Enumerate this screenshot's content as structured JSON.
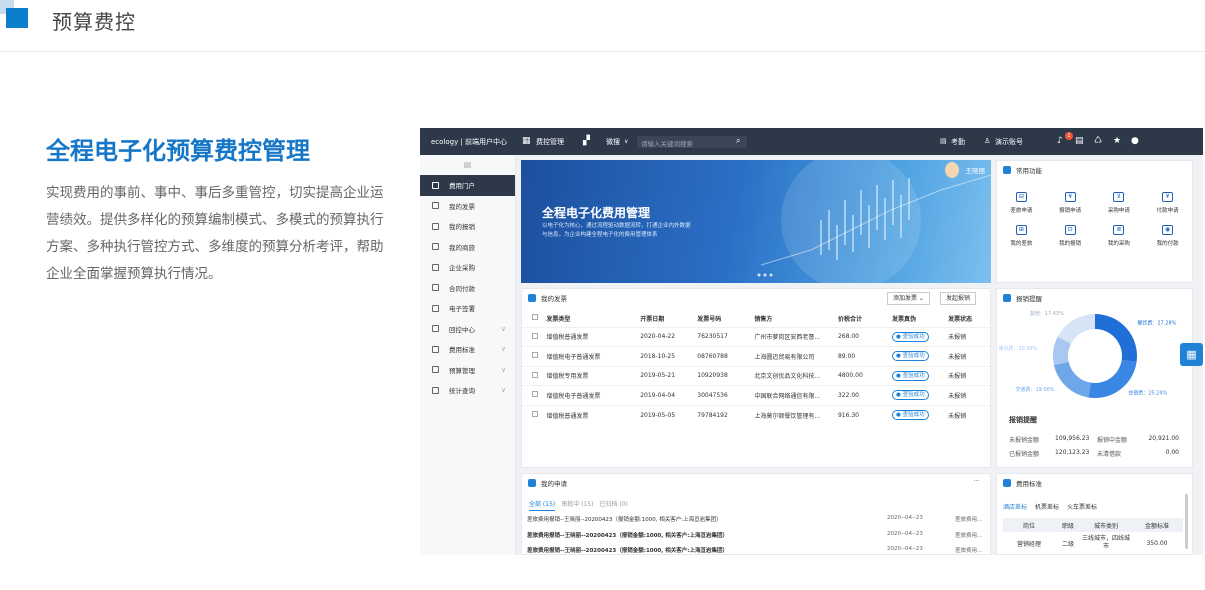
{
  "header": {
    "title": "预算费控"
  },
  "headline": "全程电子化预算费控管理",
  "description": "实现费用的事前、事中、事后多重管控，切实提高企业运营绩效。提供多样化的预算编制模式、多模式的预算执行方案、多种执行管控方式、多维度的预算分析考评，帮助企业全面掌握预算执行情况。",
  "app": {
    "brand": "ecology | 前端用户中心",
    "module": "费控管理",
    "search_scope": "微搜",
    "search_placeholder": "请输入关键词搜索",
    "attendance": "考勤",
    "account": "演示账号",
    "notification_count": "1",
    "sidebar": [
      {
        "label": "费用门户",
        "active": true
      },
      {
        "label": "我的发票"
      },
      {
        "label": "我的报销"
      },
      {
        "label": "我的商旅"
      },
      {
        "label": "企业采购"
      },
      {
        "label": "合同付款"
      },
      {
        "label": "电子签署"
      },
      {
        "label": "回控中心",
        "expand": true
      },
      {
        "label": "费用标准",
        "expand": true
      },
      {
        "label": "预算管理",
        "expand": true
      },
      {
        "label": "统计查询",
        "expand": true
      }
    ],
    "banner": {
      "title": "全程电子化费用管理",
      "subtitle": "以电子化为核心，通过流程驱动数据流转，打通企业内外数据与信息，为企业构建全程电子化的费用管理体系",
      "user": "王晓丽"
    },
    "quick": {
      "title": "常用功能",
      "items": [
        "差旅申请",
        "报销申请",
        "采购申请",
        "付款申请",
        "我的差旅",
        "我的报销",
        "我的采购",
        "我的付款"
      ],
      "icons": [
        "briefcase-icon",
        "yen-icon",
        "cart-icon",
        "payment-icon",
        "travel-icon",
        "receipt-icon",
        "purchase-icon",
        "pay-icon"
      ]
    },
    "invoices": {
      "title": "我的发票",
      "add_button": "添加发票",
      "reimburse_button": "发起报销",
      "columns": [
        "发票类型",
        "开票日期",
        "发票号码",
        "销售方",
        "价税合计",
        "发票真伪",
        "发票状态"
      ],
      "rows": [
        [
          "增值税普通发票",
          "2020-04-22",
          "76230517",
          "广州市萝岗区安西老督...",
          "268.00",
          "查验成功",
          "未报销"
        ],
        [
          "增值税电子普通发票",
          "2018-10-25",
          "08760788",
          "上海圆迈贸易有限公司",
          "89.00",
          "查验成功",
          "未报销"
        ],
        [
          "增值税专用发票",
          "2019-05-21",
          "10920938",
          "北京文创优品文化科技...",
          "4800.00",
          "查验成功",
          "未报销"
        ],
        [
          "增值税电子普通发票",
          "2019-04-04",
          "30047536",
          "中国联合网络通信有限...",
          "322.00",
          "查验成功",
          "未报销"
        ],
        [
          "增值税普通发票",
          "2019-05-05",
          "79784192",
          "上海莫尔顿餐饮管理有...",
          "916.30",
          "查验成功",
          "未报销"
        ]
      ]
    },
    "reminder": {
      "title": "报销提醒",
      "chart_data": {
        "type": "pie",
        "labels": [
          "餐饮费",
          "住宿费",
          "交通费",
          "通讯费",
          "其他"
        ],
        "values": [
          27.28,
          25.24,
          19.06,
          10.99,
          17.43
        ],
        "value_labels": [
          "餐饮费：27.28%",
          "住宿费：25.24%",
          "交通费：19.06%",
          "通讯费：10.99%",
          "其他：17.43%"
        ],
        "colors": [
          "#1f6fd6",
          "#3a86e4",
          "#6ea6ea",
          "#a9c8f1",
          "#d6e4f6"
        ]
      },
      "summary_title": "报销提醒",
      "stats": [
        {
          "label": "未报销金额",
          "value": "109,956.23",
          "label2": "报销中金额",
          "value2": "20,921.00"
        },
        {
          "label": "已报销金额",
          "value": "120,123.23",
          "label2": "未清借款",
          "value2": "0.00"
        }
      ]
    },
    "applications": {
      "title": "我的申请",
      "more": "···",
      "tabs": [
        "全部 (15)",
        "审批中 (15)",
        "已归档 (0)"
      ],
      "rows": [
        {
          "text": "差旅费用报销--王晓丽--20200423（报销金额:1000, 相关客户:上海亘岩集团）",
          "date": "2020--04--23",
          "status": "差旅费用..."
        },
        {
          "text": "差旅费用报销--王晓丽--20200423（报销金额:1000, 相关客户:上海亘岩集团）",
          "date": "2020--04--23",
          "status": "差旅费用..."
        },
        {
          "text": "差旅费用报销--王晓丽--20200423（报销金额:1000, 相关客户:上海亘岩集团）",
          "date": "2020--04--23",
          "status": "差旅费用..."
        }
      ]
    },
    "standards": {
      "title": "费用标准",
      "tabs": [
        "酒店差标",
        "机票差标",
        "火车票差标"
      ],
      "columns": [
        "岗位",
        "职级",
        "城市类别",
        "金额标准"
      ],
      "rows": [
        [
          "营销经理",
          "二级",
          "三线城市，四线城市",
          "350.00"
        ]
      ]
    }
  }
}
